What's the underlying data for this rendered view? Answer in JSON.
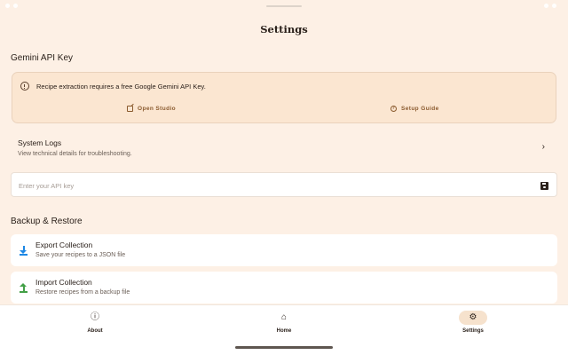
{
  "header": {
    "title": "Settings"
  },
  "gemini": {
    "section_title": "Gemini API Key",
    "info_text": "Recipe extraction requires a free Google Gemini API Key.",
    "info_icon": "info-icon",
    "open_studio_label": "Open Studio",
    "open_studio_icon": "external-link-icon",
    "setup_guide_label": "Setup Guide",
    "setup_guide_icon": "help-circle-icon"
  },
  "logs": {
    "title": "System Logs",
    "subtitle": "View technical details for troubleshooting.",
    "icon": "chevron-right-icon"
  },
  "api_input": {
    "placeholder": "Enter your API key",
    "value": "",
    "icon": "save-icon"
  },
  "backup": {
    "section_title": "Backup & Restore",
    "export_title": "Export Collection",
    "export_sub": "Save your recipes to a JSON file",
    "export_icon": "download-icon",
    "export_color": "#1e88e5",
    "import_title": "Import Collection",
    "import_sub": "Restore recipes from a backup file",
    "import_icon": "upload-icon",
    "import_color": "#43a047"
  },
  "nav": {
    "items": [
      {
        "label": "About",
        "icon": "info-icon",
        "active": false
      },
      {
        "label": "Home",
        "icon": "home-icon",
        "active": false
      },
      {
        "label": "Settings",
        "icon": "gear-icon",
        "active": true
      }
    ]
  },
  "colors": {
    "background": "#fdf0e5",
    "info_card": "#fbe6d1",
    "accent": "#8a5a2e",
    "active_nav": "#f6e2cd"
  }
}
